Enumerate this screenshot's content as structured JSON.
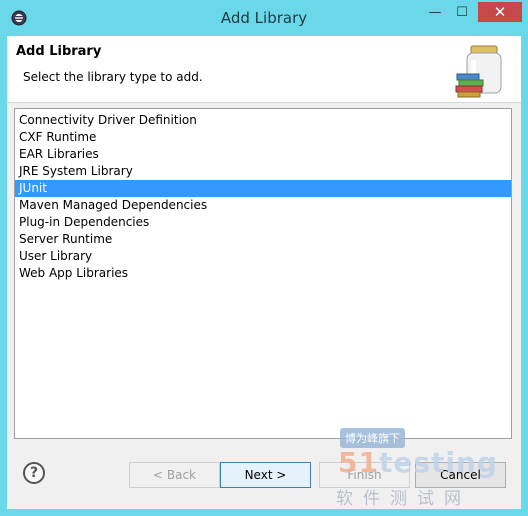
{
  "window": {
    "title": "Add Library",
    "minimize_glyph": "—",
    "maximize_glyph": "☐",
    "close_glyph": "✕"
  },
  "header": {
    "title": "Add Library",
    "description": "Select the library type to add."
  },
  "library_types": [
    {
      "label": "Connectivity Driver Definition",
      "selected": false
    },
    {
      "label": "CXF Runtime",
      "selected": false
    },
    {
      "label": "EAR Libraries",
      "selected": false
    },
    {
      "label": "JRE System Library",
      "selected": false
    },
    {
      "label": "JUnit",
      "selected": true
    },
    {
      "label": "Maven Managed Dependencies",
      "selected": false
    },
    {
      "label": "Plug-in Dependencies",
      "selected": false
    },
    {
      "label": "Server Runtime",
      "selected": false
    },
    {
      "label": "User Library",
      "selected": false
    },
    {
      "label": "Web App Libraries",
      "selected": false
    }
  ],
  "footer": {
    "help_glyph": "?",
    "back_label": "< Back",
    "next_label": "Next >",
    "finish_label": "Finish",
    "cancel_label": "Cancel"
  },
  "watermark": {
    "top_text": "博为峰旗下",
    "logo_number": "51",
    "logo_text": "testing",
    "bottom_text": "软件测试网"
  },
  "colors": {
    "titlebar": "#6ad8e8",
    "selection": "#3399ff",
    "close_button": "#c74848"
  }
}
